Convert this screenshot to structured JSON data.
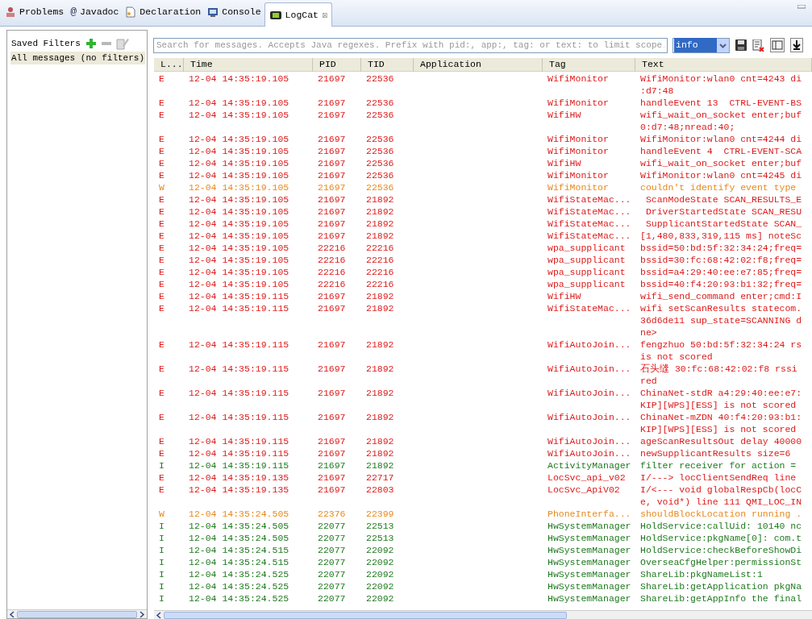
{
  "tabs": [
    {
      "label": "Problems",
      "selected": false
    },
    {
      "label": "Javadoc",
      "selected": false,
      "icon": "@"
    },
    {
      "label": "Declaration",
      "selected": false
    },
    {
      "label": "Console",
      "selected": false
    },
    {
      "label": "LogCat",
      "selected": true,
      "close": "☒"
    }
  ],
  "filters": {
    "title": "Saved Filters",
    "items": [
      {
        "label": "All messages (no filters)",
        "selected": true
      }
    ]
  },
  "search": {
    "placeholder": "Search for messages. Accepts Java regexes. Prefix with pid:, app:, tag: or text: to limit scope."
  },
  "level_select": {
    "value": "info"
  },
  "table": {
    "columns": [
      "L...",
      "Time",
      "PID",
      "TID",
      "Application",
      "Tag",
      "Text"
    ],
    "rows": [
      {
        "kind": "error",
        "level": "E",
        "time": "12-04 14:35:19.105",
        "pid": "21697",
        "tid": "22536",
        "tag": "WifiMonitor",
        "text": [
          "WifiMonitor:wlan0 cnt=4243 di",
          ":d7:48"
        ]
      },
      {
        "kind": "error",
        "level": "E",
        "time": "12-04 14:35:19.105",
        "pid": "21697",
        "tid": "22536",
        "tag": "WifiMonitor",
        "text": [
          "handleEvent 13  CTRL-EVENT-BS"
        ]
      },
      {
        "kind": "error",
        "level": "E",
        "time": "12-04 14:35:19.105",
        "pid": "21697",
        "tid": "22536",
        "tag": "WifiHW",
        "text": [
          "wifi_wait_on_socket enter;buf",
          "0:d7:48;nread:40;"
        ]
      },
      {
        "kind": "error",
        "level": "E",
        "time": "12-04 14:35:19.105",
        "pid": "21697",
        "tid": "22536",
        "tag": "WifiMonitor",
        "text": [
          "WifiMonitor:wlan0 cnt=4244 di"
        ]
      },
      {
        "kind": "error",
        "level": "E",
        "time": "12-04 14:35:19.105",
        "pid": "21697",
        "tid": "22536",
        "tag": "WifiMonitor",
        "text": [
          "handleEvent 4  CTRL-EVENT-SCA"
        ]
      },
      {
        "kind": "error",
        "level": "E",
        "time": "12-04 14:35:19.105",
        "pid": "21697",
        "tid": "22536",
        "tag": "WifiHW",
        "text": [
          "wifi_wait_on_socket enter;buf"
        ]
      },
      {
        "kind": "error",
        "level": "E",
        "time": "12-04 14:35:19.105",
        "pid": "21697",
        "tid": "22536",
        "tag": "WifiMonitor",
        "text": [
          "WifiMonitor:wlan0 cnt=4245 di"
        ]
      },
      {
        "kind": "warning",
        "level": "W",
        "time": "12-04 14:35:19.105",
        "pid": "21697",
        "tid": "22536",
        "tag": "WifiMonitor",
        "text": [
          "couldn't identify event type"
        ]
      },
      {
        "kind": "error",
        "level": "E",
        "time": "12-04 14:35:19.105",
        "pid": "21697",
        "tid": "21892",
        "tag": "WifiStateMac...",
        "text": [
          " ScanModeState SCAN_RESULTS_E"
        ]
      },
      {
        "kind": "error",
        "level": "E",
        "time": "12-04 14:35:19.105",
        "pid": "21697",
        "tid": "21892",
        "tag": "WifiStateMac...",
        "text": [
          " DriverStartedState SCAN_RESU"
        ]
      },
      {
        "kind": "error",
        "level": "E",
        "time": "12-04 14:35:19.105",
        "pid": "21697",
        "tid": "21892",
        "tag": "WifiStateMac...",
        "text": [
          " SupplicantStartedState SCAN_"
        ]
      },
      {
        "kind": "error",
        "level": "E",
        "time": "12-04 14:35:19.105",
        "pid": "21697",
        "tid": "21892",
        "tag": "WifiStateMac...",
        "text": [
          "[1,480,833,319,115 ms] noteSc"
        ]
      },
      {
        "kind": "error",
        "level": "E",
        "time": "12-04 14:35:19.105",
        "pid": "22216",
        "tid": "22216",
        "tag": "wpa_supplicant",
        "text": [
          "bssid=50:bd:5f:32:34:24;freq="
        ]
      },
      {
        "kind": "error",
        "level": "E",
        "time": "12-04 14:35:19.105",
        "pid": "22216",
        "tid": "22216",
        "tag": "wpa_supplicant",
        "text": [
          "bssid=30:fc:68:42:02:f8;freq="
        ]
      },
      {
        "kind": "error",
        "level": "E",
        "time": "12-04 14:35:19.105",
        "pid": "22216",
        "tid": "22216",
        "tag": "wpa_supplicant",
        "text": [
          "bssid=a4:29:40:ee:e7:85;freq="
        ]
      },
      {
        "kind": "error",
        "level": "E",
        "time": "12-04 14:35:19.105",
        "pid": "22216",
        "tid": "22216",
        "tag": "wpa_supplicant",
        "text": [
          "bssid=40:f4:20:93:b1:32;freq="
        ]
      },
      {
        "kind": "error",
        "level": "E",
        "time": "12-04 14:35:19.115",
        "pid": "21697",
        "tid": "21892",
        "tag": "WifiHW",
        "text": [
          "wifi_send_command enter;cmd:I"
        ]
      },
      {
        "kind": "error",
        "level": "E",
        "time": "12-04 14:35:19.115",
        "pid": "21697",
        "tid": "21892",
        "tag": "WifiStateMac...",
        "text": [
          "wifi setScanResults statecom.",
          "36d6de11 sup_state=SCANNING d",
          "ne>"
        ]
      },
      {
        "kind": "error",
        "level": "E",
        "time": "12-04 14:35:19.115",
        "pid": "21697",
        "tid": "21892",
        "tag": "WifiAutoJoin...",
        "text": [
          "fengzhuo 50:bd:5f:32:34:24 rs",
          "is not scored"
        ]
      },
      {
        "kind": "error",
        "level": "E",
        "time": "12-04 14:35:19.115",
        "pid": "21697",
        "tid": "21892",
        "tag": "WifiAutoJoin...",
        "text": [
          "石头缝 30:fc:68:42:02:f8 rssi",
          "red"
        ]
      },
      {
        "kind": "error",
        "level": "E",
        "time": "12-04 14:35:19.115",
        "pid": "21697",
        "tid": "21892",
        "tag": "WifiAutoJoin...",
        "text": [
          "ChinaNet-stdR a4:29:40:ee:e7:",
          "KIP][WPS][ESS] is not scored"
        ]
      },
      {
        "kind": "error",
        "level": "E",
        "time": "12-04 14:35:19.115",
        "pid": "21697",
        "tid": "21892",
        "tag": "WifiAutoJoin...",
        "text": [
          "ChinaNet-mZDN 40:f4:20:93:b1:",
          "KIP][WPS][ESS] is not scored"
        ]
      },
      {
        "kind": "error",
        "level": "E",
        "time": "12-04 14:35:19.115",
        "pid": "21697",
        "tid": "21892",
        "tag": "WifiAutoJoin...",
        "text": [
          "ageScanResultsOut delay 40000"
        ]
      },
      {
        "kind": "error",
        "level": "E",
        "time": "12-04 14:35:19.115",
        "pid": "21697",
        "tid": "21892",
        "tag": "WifiAutoJoin...",
        "text": [
          "newSupplicantResults size=6"
        ]
      },
      {
        "kind": "info",
        "level": "I",
        "time": "12-04 14:35:19.115",
        "pid": "21697",
        "tid": "21892",
        "tag": "ActivityManager",
        "text": [
          "filter receiver for action ="
        ]
      },
      {
        "kind": "error",
        "level": "E",
        "time": "12-04 14:35:19.135",
        "pid": "21697",
        "tid": "22717",
        "tag": "LocSvc_api_v02",
        "text": [
          "I/---> locClientSendReq line"
        ]
      },
      {
        "kind": "error",
        "level": "E",
        "time": "12-04 14:35:19.135",
        "pid": "21697",
        "tid": "22803",
        "tag": "LocSvc_ApiV02",
        "text": [
          "I/<--- void globalRespCb(locC",
          "e, void*) line 111 QMI_LOC_IN"
        ]
      },
      {
        "kind": "warning",
        "level": "W",
        "time": "12-04 14:35:24.505",
        "pid": "22376",
        "tid": "22399",
        "tag": "PhoneInterfa...",
        "text": [
          "shouldBlockLocation running ."
        ]
      },
      {
        "kind": "info",
        "level": "I",
        "time": "12-04 14:35:24.505",
        "pid": "22077",
        "tid": "22513",
        "tag": "HwSystemManager",
        "text": [
          "HoldService:callUid: 10140 nc"
        ]
      },
      {
        "kind": "info",
        "level": "I",
        "time": "12-04 14:35:24.505",
        "pid": "22077",
        "tid": "22513",
        "tag": "HwSystemManager",
        "text": [
          "HoldService:pkgName[0]: com.t"
        ]
      },
      {
        "kind": "info",
        "level": "I",
        "time": "12-04 14:35:24.515",
        "pid": "22077",
        "tid": "22092",
        "tag": "HwSystemManager",
        "text": [
          "HoldService:checkBeforeShowDi"
        ]
      },
      {
        "kind": "info",
        "level": "I",
        "time": "12-04 14:35:24.515",
        "pid": "22077",
        "tid": "22092",
        "tag": "HwSystemManager",
        "text": [
          "OverseaCfgHelper:permissionSt"
        ]
      },
      {
        "kind": "info",
        "level": "I",
        "time": "12-04 14:35:24.525",
        "pid": "22077",
        "tid": "22092",
        "tag": "HwSystemManager",
        "text": [
          "ShareLib:pkgNameList:1"
        ]
      },
      {
        "kind": "info",
        "level": "I",
        "time": "12-04 14:35:24.525",
        "pid": "22077",
        "tid": "22092",
        "tag": "HwSystemManager",
        "text": [
          "ShareLib:getApplication pkgNa"
        ]
      },
      {
        "kind": "info",
        "level": "I",
        "time": "12-04 14:35:24.525",
        "pid": "22077",
        "tid": "22092",
        "tag": "HwSystemManager",
        "text": [
          "ShareLib:getAppInfo the final"
        ]
      }
    ]
  }
}
